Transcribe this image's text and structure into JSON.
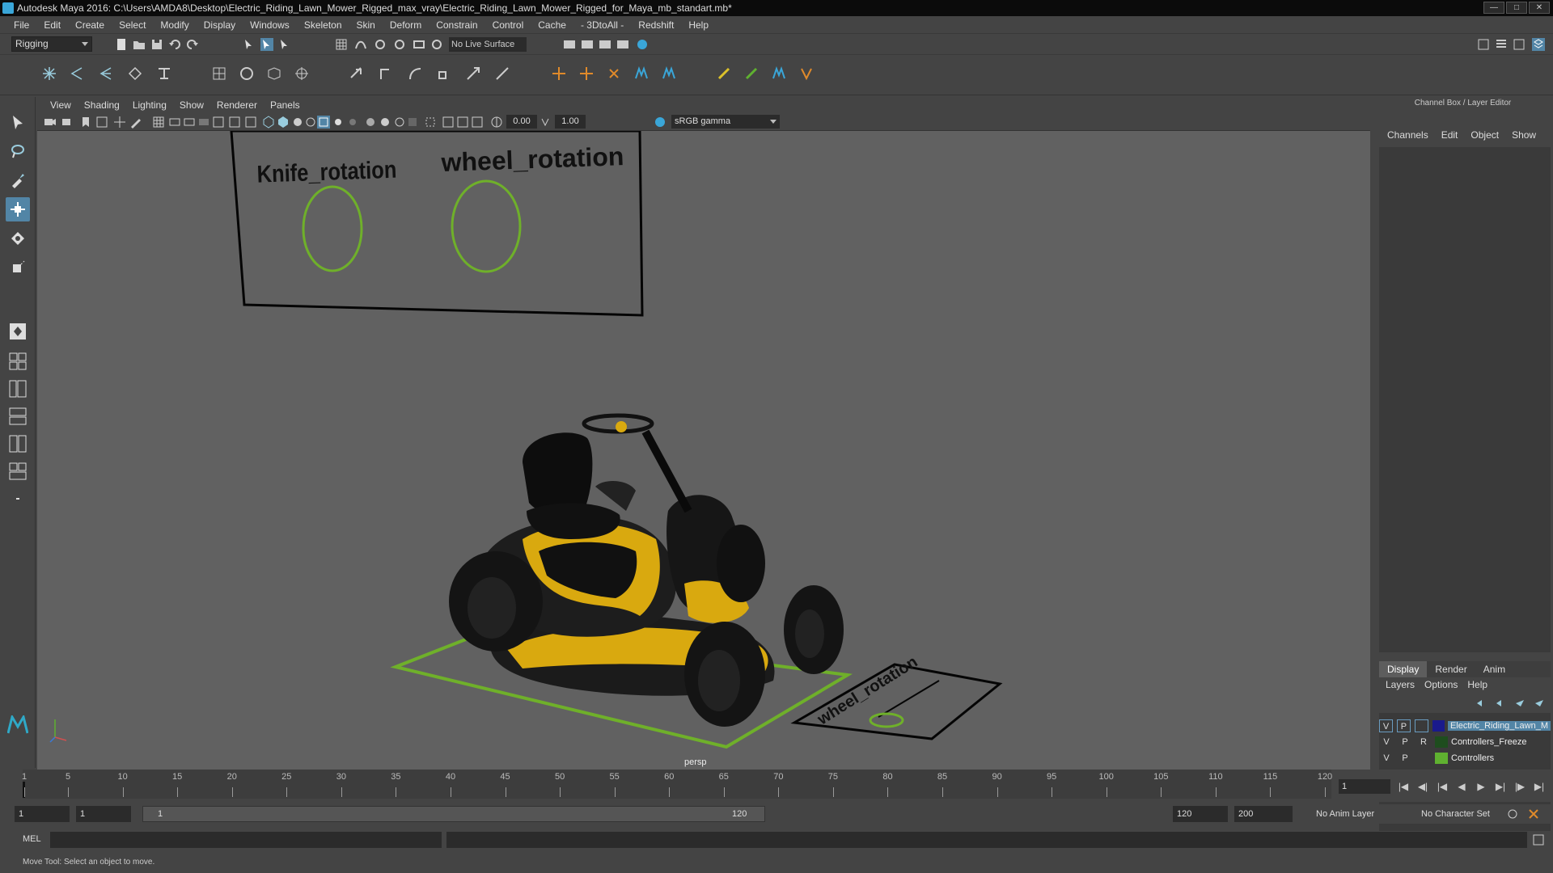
{
  "window": {
    "title": "Autodesk Maya 2016: C:\\Users\\AMDA8\\Desktop\\Electric_Riding_Lawn_Mower_Rigged_max_vray\\Electric_Riding_Lawn_Mower_Rigged_for_Maya_mb_standart.mb*"
  },
  "menubar": {
    "items": [
      "File",
      "Edit",
      "Create",
      "Select",
      "Modify",
      "Display",
      "Windows",
      "Skeleton",
      "Skin",
      "Deform",
      "Constrain",
      "Control",
      "Cache",
      "- 3DtoAll -",
      "Redshift",
      "Help"
    ]
  },
  "shelf": {
    "mode": "Rigging",
    "live_surface": "No Live Surface"
  },
  "viewport": {
    "menu": [
      "View",
      "Shading",
      "Lighting",
      "Show",
      "Renderer",
      "Panels"
    ],
    "exposure": "0.00",
    "gamma": "1.00",
    "color_space": "sRGB gamma",
    "camera_label": "persp",
    "scene_labels": {
      "knife": "Knife_rotation",
      "wheel": "wheel_rotation",
      "wheel_plate": "wheel_rotation"
    }
  },
  "channelbox": {
    "title": "Channel Box / Layer Editor",
    "tabs": [
      "Channels",
      "Edit",
      "Object",
      "Show"
    ]
  },
  "layer_editor": {
    "tabs": [
      "Display",
      "Render",
      "Anim"
    ],
    "menu": [
      "Layers",
      "Options",
      "Help"
    ],
    "layers": [
      {
        "v": "V",
        "p": "P",
        "r": "",
        "name": "Electric_Riding_Lawn_M",
        "color": "#1a1a8c",
        "selected": true
      },
      {
        "v": "V",
        "p": "P",
        "r": "R",
        "name": "Controllers_Freeze",
        "color": "#1e4d1e",
        "selected": false
      },
      {
        "v": "V",
        "p": "P",
        "r": "",
        "name": "Controllers",
        "color": "#5fb130",
        "selected": false
      }
    ]
  },
  "timeline": {
    "ticks": [
      "1",
      "5",
      "10",
      "15",
      "20",
      "25",
      "30",
      "35",
      "40",
      "45",
      "50",
      "55",
      "60",
      "65",
      "70",
      "75",
      "80",
      "85",
      "90",
      "95",
      "100",
      "105",
      "110",
      "115",
      "120"
    ],
    "current_frame": "1"
  },
  "range": {
    "start": "1",
    "playback_start": "1",
    "slider_start": "1",
    "slider_end": "120",
    "playback_end": "120",
    "end": "200",
    "anim_layer": "No Anim Layer",
    "character_set": "No Character Set"
  },
  "cmdline": {
    "label": "MEL"
  },
  "helpline": {
    "text": "Move Tool: Select an object to move."
  },
  "colors": {
    "accent": "#5285a6",
    "control_curve": "#6fb02a",
    "viewport_bg": "#616161"
  }
}
